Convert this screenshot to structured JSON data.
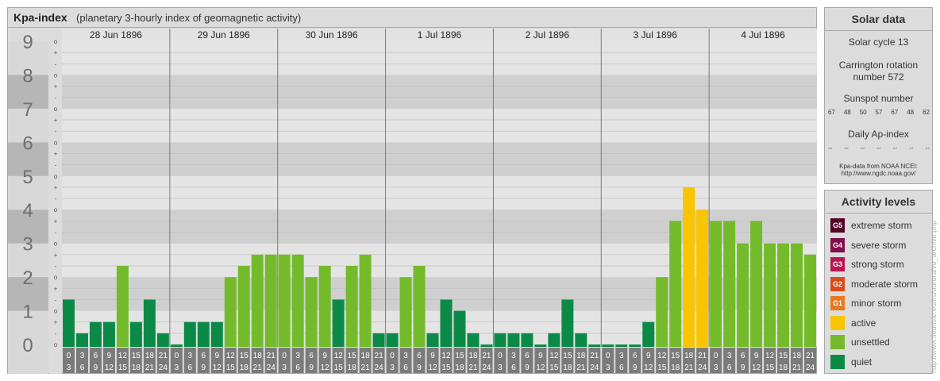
{
  "header": {
    "title": "Kpa-index",
    "subtitle": "(planetary 3-hourly index of geomagnetic activity)"
  },
  "chart_data": {
    "type": "bar",
    "ylim": [
      0,
      9
    ],
    "y_ticks": [
      "0",
      "1",
      "2",
      "3",
      "4",
      "5",
      "6",
      "7",
      "8",
      "9"
    ],
    "sub_marks": [
      "o",
      "-",
      "+"
    ],
    "days": [
      "28 Jun 1896",
      "29 Jun 1896",
      "30 Jun 1896",
      "1 Jul 1896",
      "2 Jul 1896",
      "3 Jul 1896",
      "4 Jul 1896"
    ],
    "intervals": [
      [
        "0",
        "3"
      ],
      [
        "3",
        "6"
      ],
      [
        "6",
        "9"
      ],
      [
        "9",
        "12"
      ],
      [
        "12",
        "15"
      ],
      [
        "15",
        "18"
      ],
      [
        "18",
        "21"
      ],
      [
        "21",
        "24"
      ]
    ],
    "values": [
      1.333,
      0.333,
      0.667,
      0.667,
      2.333,
      0.667,
      1.333,
      0.333,
      0.0,
      0.667,
      0.667,
      0.667,
      2.0,
      2.333,
      2.667,
      2.667,
      2.667,
      2.667,
      2.0,
      2.333,
      1.333,
      2.333,
      2.667,
      0.333,
      0.333,
      2.0,
      2.333,
      0.333,
      1.333,
      1.0,
      0.333,
      0.0,
      0.333,
      0.333,
      0.333,
      0.0,
      0.333,
      1.333,
      0.333,
      0.0,
      0.0,
      0.0,
      0.0,
      0.667,
      2.0,
      3.667,
      4.667,
      4.0,
      3.667,
      3.667,
      3.0,
      3.667,
      3.0,
      3.0,
      3.0,
      2.667
    ],
    "colors": {
      "quiet": "#0b8a47",
      "unsettled": "#74bb2c",
      "active": "#f9c400",
      "minor": "#e6791f",
      "moderate": "#d84c1c",
      "strong": "#b8164e",
      "severe": "#7f1049",
      "extreme": "#520025"
    }
  },
  "solar": {
    "title": "Solar data",
    "cycle": "Solar cycle 13",
    "carrington_1": "Carrington rotation",
    "carrington_2": "number 572",
    "sunspot_title": "Sunspot number",
    "sunspots": [
      "67",
      "48",
      "50",
      "57",
      "67",
      "48",
      "62"
    ],
    "ap_title": "Daily Ap-index",
    "ap_values": [
      "--",
      "--",
      "--",
      "--",
      "--",
      "--",
      "--"
    ],
    "source_1": "Kpa-data from NOAA NCEI:",
    "source_2": "http://www.ngdc.noaa.gov/"
  },
  "activity": {
    "title": "Activity levels",
    "levels": [
      {
        "badge": "G5",
        "label": "extreme storm",
        "color": "#520025"
      },
      {
        "badge": "G4",
        "label": "severe storm",
        "color": "#7f1049"
      },
      {
        "badge": "G3",
        "label": "strong storm",
        "color": "#b8164e"
      },
      {
        "badge": "G2",
        "label": "moderate storm",
        "color": "#d84c1c"
      },
      {
        "badge": "G1",
        "label": "minor storm",
        "color": "#e6791f"
      },
      {
        "badge": "",
        "label": "active",
        "color": "#f9c400"
      },
      {
        "badge": "",
        "label": "unsettled",
        "color": "#74bb2c"
      },
      {
        "badge": "",
        "label": "quiet",
        "color": "#0b8a47"
      }
    ]
  },
  "credit": "http://www.fleuriste.eu/irs/aurora/vo_archive.php"
}
